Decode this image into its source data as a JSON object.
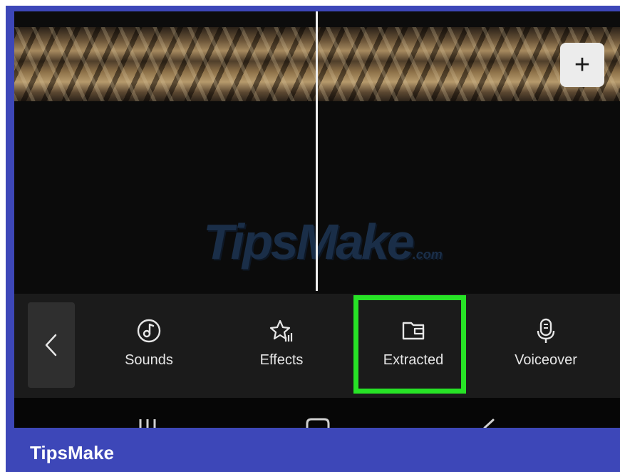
{
  "timeline": {
    "add_label": "+"
  },
  "watermark": {
    "text": "TipsMake",
    "suffix": ".com"
  },
  "toolbar": {
    "items": [
      {
        "label": "Sounds",
        "icon": "music-note-icon"
      },
      {
        "label": "Effects",
        "icon": "star-sparkle-icon"
      },
      {
        "label": "Extracted",
        "icon": "folder-icon"
      },
      {
        "label": "Voiceover",
        "icon": "microphone-icon"
      }
    ],
    "highlighted": "Extracted",
    "highlight_color": "#27e326"
  },
  "brand": {
    "text": "TipsMake",
    "bar_color": "#3d47b8"
  }
}
